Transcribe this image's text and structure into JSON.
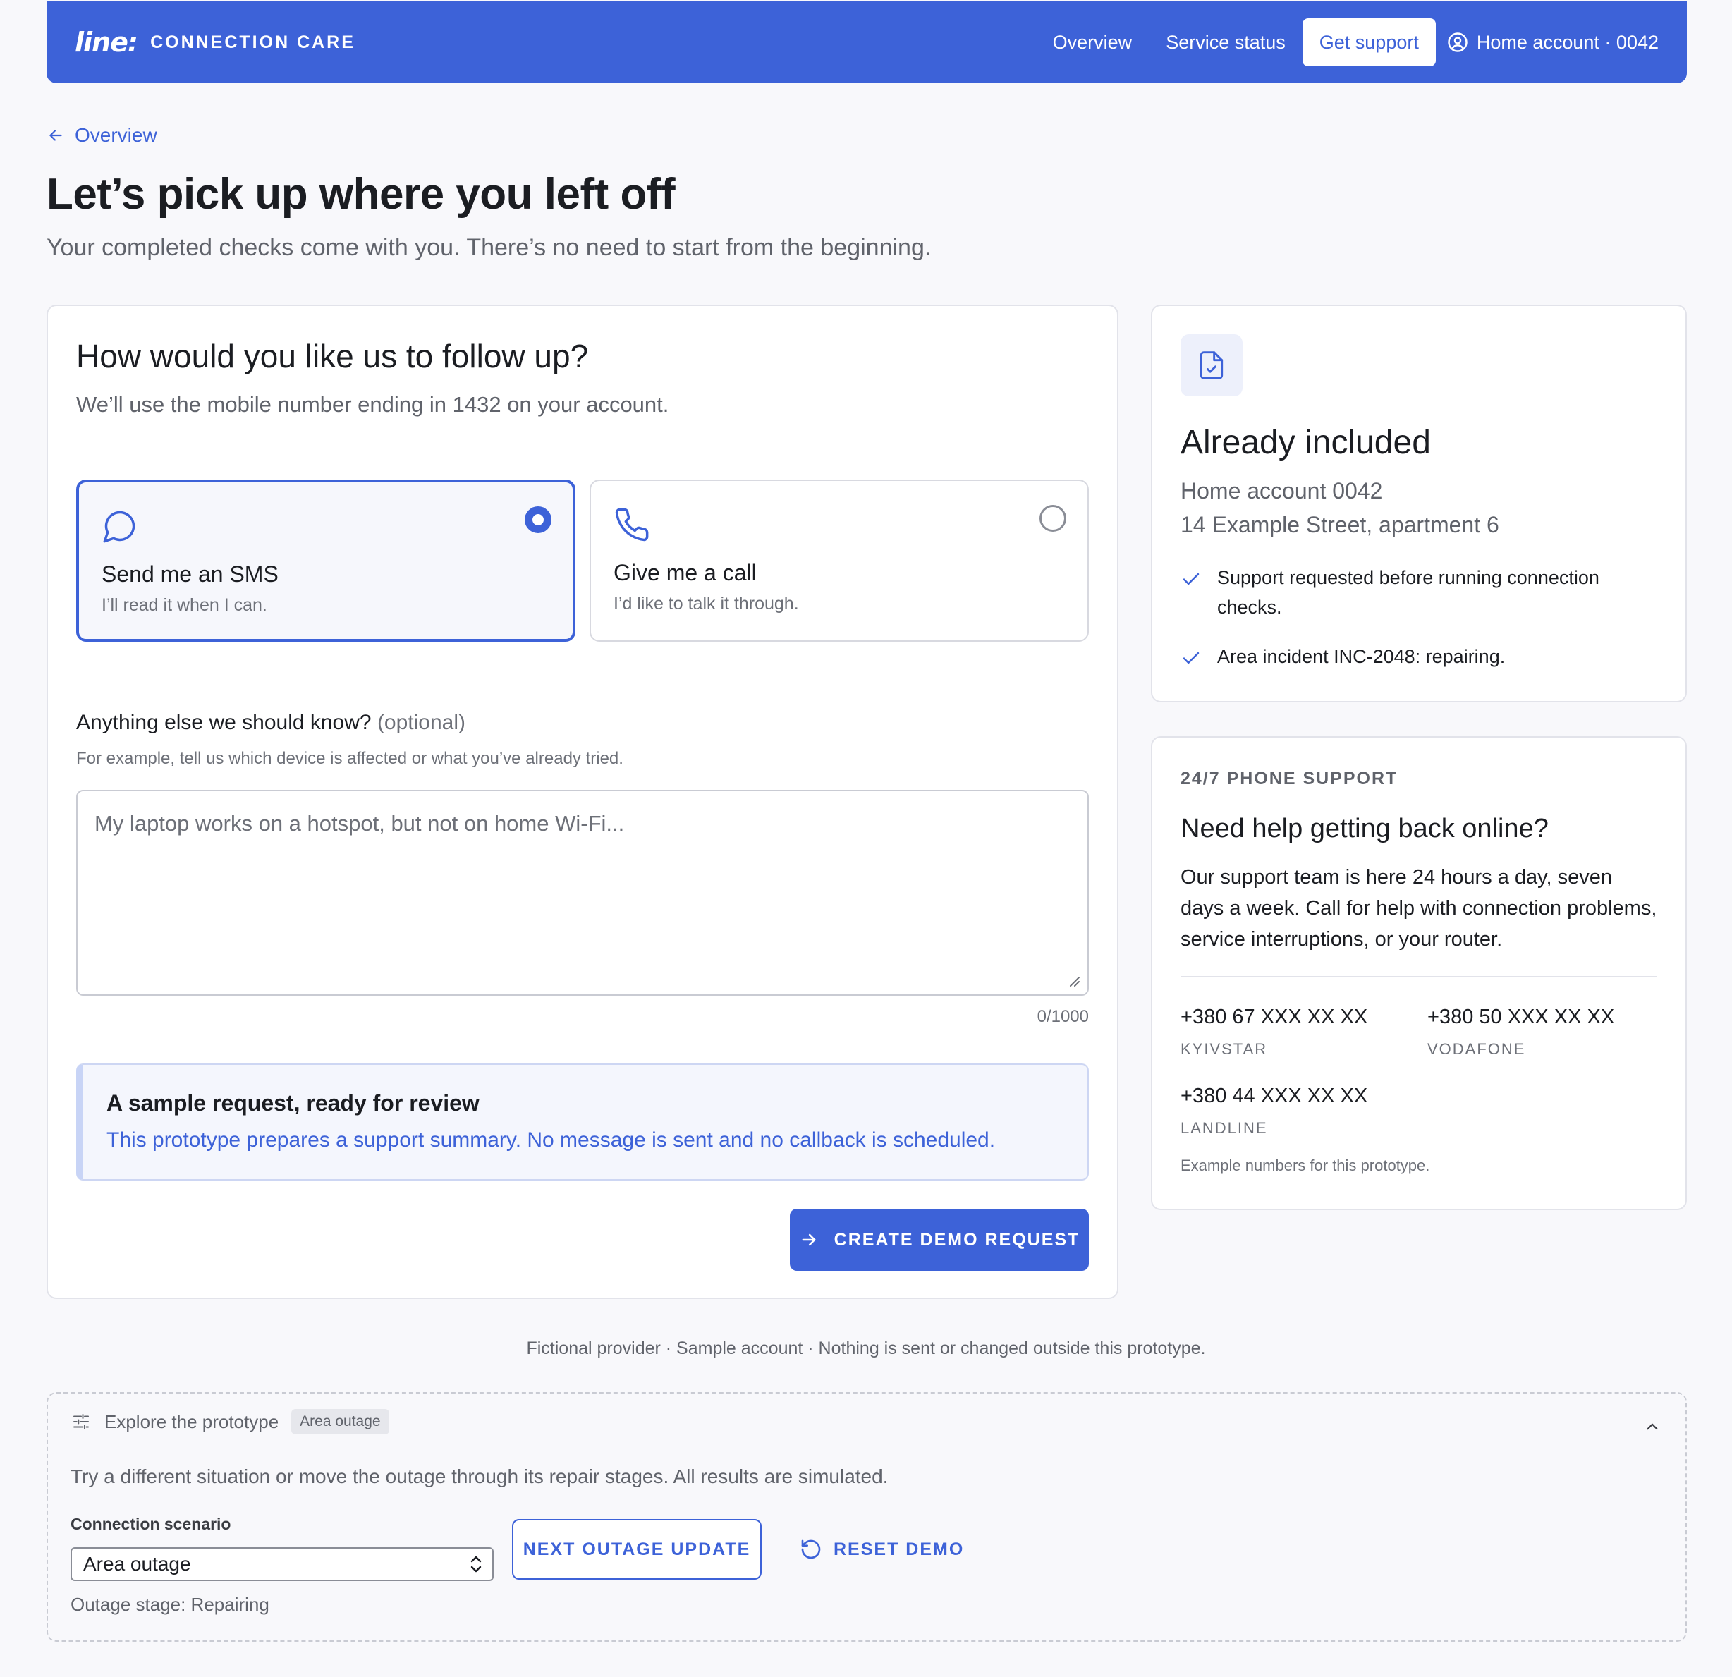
{
  "header": {
    "logo": "line:",
    "brand": "CONNECTION CARE",
    "nav": [
      "Overview",
      "Service status",
      "Get support"
    ],
    "active_nav": "Get support",
    "account": "Home account · 0042"
  },
  "page": {
    "back_label": "Overview",
    "title": "Let’s pick up where you left off",
    "subtitle": "Your completed checks come with you. There’s no need to start from the beginning."
  },
  "followup": {
    "title": "How would you like us to follow up?",
    "subtitle": "We’ll use the mobile number ending in 1432 on your account.",
    "options": [
      {
        "label": "Send me an SMS",
        "desc": "I’ll read it when I can.",
        "icon": "chat-bubble-icon",
        "selected": true
      },
      {
        "label": "Give me a call",
        "desc": "I’d like to talk it through.",
        "icon": "phone-icon",
        "selected": false
      }
    ],
    "notes_label": "Anything else we should know?",
    "notes_optional": "(optional)",
    "notes_help": "For example, tell us which device is affected or what you’ve already tried.",
    "notes_placeholder": "My laptop works on a hotspot, but not on home Wi-Fi...",
    "notes_value": "",
    "char_count": "0/1000",
    "notice_title": "A sample request, ready for review",
    "notice_body": "This prototype prepares a support summary. No message is sent and no callback is scheduled.",
    "cta": "CREATE DEMO REQUEST"
  },
  "included": {
    "title": "Already included",
    "account": "Home account 0042",
    "address": "14 Example Street, apartment 6",
    "items": [
      "Support requested before running connection checks.",
      "Area incident INC-2048: repairing."
    ]
  },
  "support": {
    "eyebrow": "24/7 PHONE SUPPORT",
    "title": "Need help getting back online?",
    "body": "Our support team is here 24 hours a day, seven days a week. Call for help with connection problems, service interruptions, or your router.",
    "phones": [
      {
        "number": "+380 67 XXX XX XX",
        "label": "KYIVSTAR"
      },
      {
        "number": "+380 50 XXX XX XX",
        "label": "VODAFONE"
      },
      {
        "number": "+380 44 XXX XX XX",
        "label": "LANDLINE"
      }
    ],
    "footnote": "Example numbers for this prototype."
  },
  "footer_note": "Fictional provider · Sample account · Nothing is sent or changed outside this prototype.",
  "demo": {
    "title": "Explore the prototype",
    "badge": "Area outage",
    "description": "Try a different situation or move the outage through its repair stages. All results are simulated.",
    "scenario_label": "Connection scenario",
    "scenario_value": "Area outage",
    "stage": "Outage stage: Repairing",
    "next_button": "NEXT OUTAGE UPDATE",
    "reset_button": "RESET DEMO"
  },
  "colors": {
    "accent": "#3d62d8",
    "background": "#f8f8fb",
    "text": "#1b1d22",
    "muted": "#60636b"
  }
}
